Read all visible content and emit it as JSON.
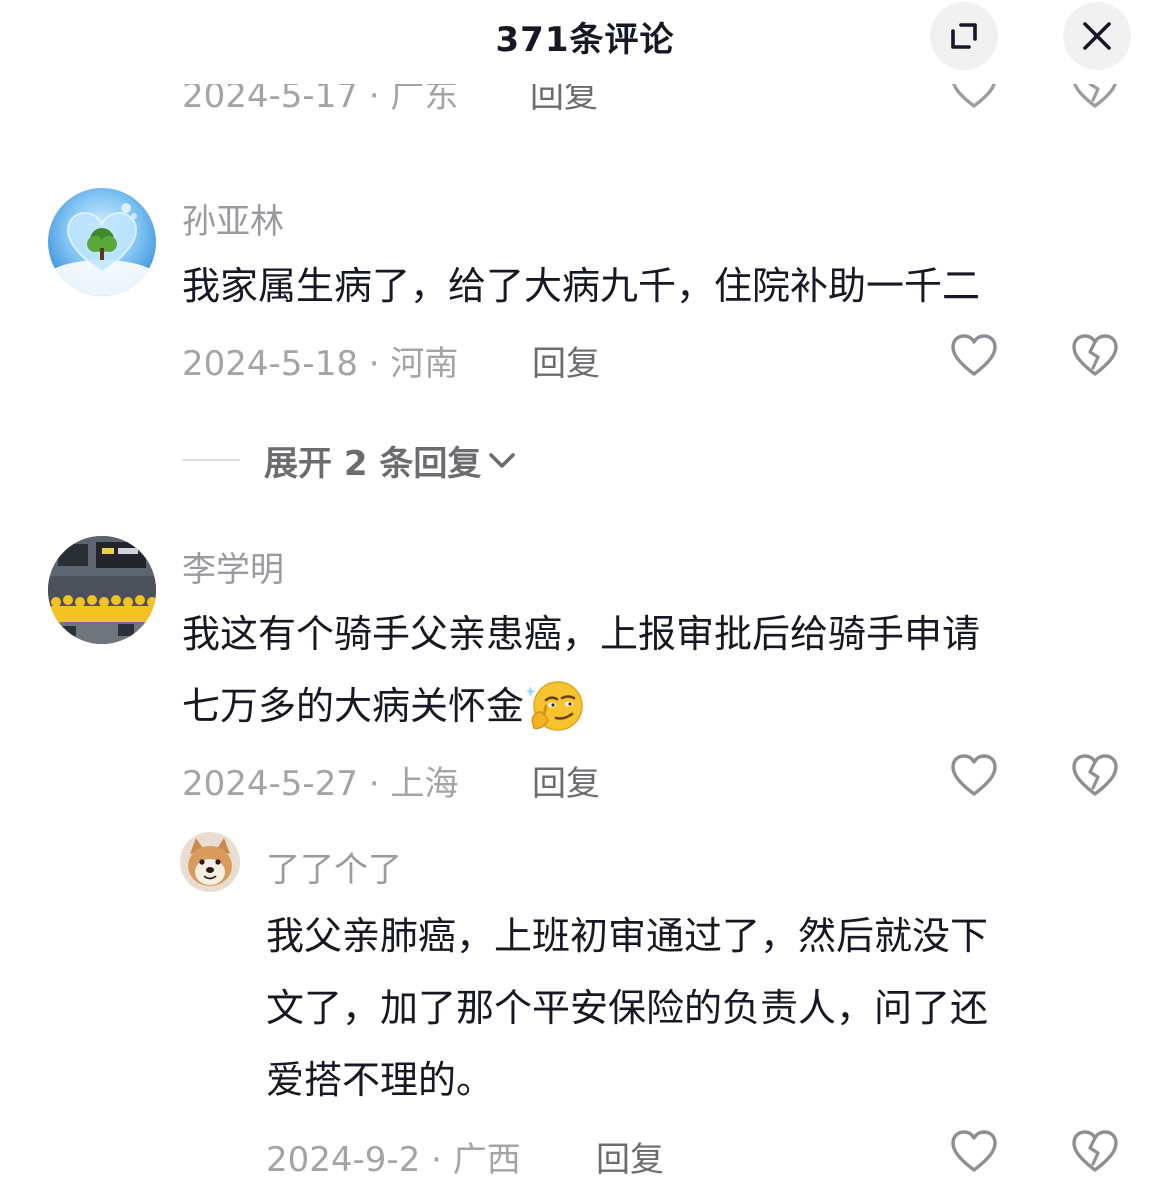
{
  "header": {
    "title": "371条评论",
    "expand_icon": "expand-icon",
    "close_icon": "close-icon"
  },
  "partial_comment": {
    "meta": "2024-5-17 · 广东",
    "reply_label": "回复"
  },
  "comments": [
    {
      "username": "孙亚林",
      "avatar_icon": "heart-tree-avatar",
      "lines": [
        "我家属生病了，给了大病九千，住院补助一千二"
      ],
      "meta": "2024-5-18 · 河南",
      "reply_label": "回复",
      "like_icon": "heart-outline-icon",
      "dislike_icon": "broken-heart-icon"
    },
    {
      "username": "李学明",
      "avatar_icon": "riders-group-avatar",
      "lines": [
        "我这有个骑手父亲患癌，上报审批后给骑手申请",
        "七万多的大病关怀金"
      ],
      "emoji": "thinking-smirk-emoji",
      "meta": "2024-5-27 · 上海",
      "reply_label": "回复",
      "like_icon": "heart-outline-icon",
      "dislike_icon": "broken-heart-icon"
    }
  ],
  "expand_replies": {
    "label": "展开 2 条回复",
    "icon": "chevron-down-icon"
  },
  "reply": {
    "username": "了了个了",
    "avatar_icon": "shiba-dog-avatar",
    "lines": [
      "我父亲肺癌，上班初审通过了，然后就没下",
      "文了，加了那个平安保险的负责人，问了还",
      "爱搭不理的。"
    ],
    "meta": "2024-9-2 · 广西",
    "reply_label": "回复",
    "like_icon": "heart-outline-icon",
    "dislike_icon": "broken-heart-icon"
  },
  "colors": {
    "primary_text": "#161823",
    "secondary_text": "#9a9ba0",
    "reply_link": "#6b6c70",
    "header_button_bg": "#f1f1f2"
  }
}
